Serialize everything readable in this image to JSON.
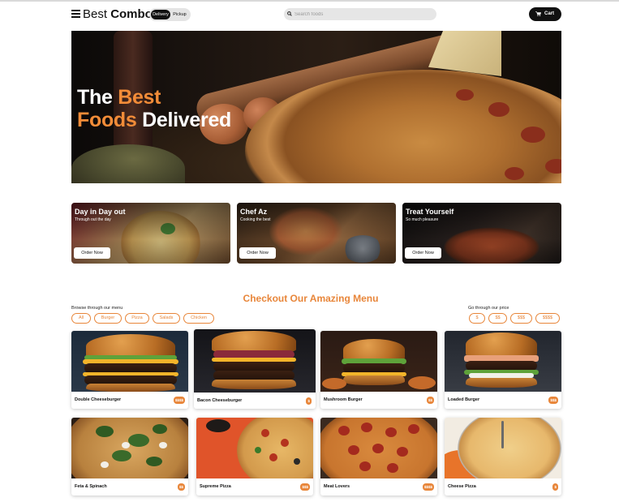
{
  "nav": {
    "brand_light": "Best",
    "brand_bold": "Combo",
    "toggle": {
      "active": "Delivery",
      "inactive": "Pickup"
    },
    "search_placeholder": "Search foods",
    "cart_label": "Cart"
  },
  "hero": {
    "line1_white": "The",
    "line1_orange": "Best",
    "line2_orange": "Foods",
    "line2_white": "Delivered"
  },
  "promos": [
    {
      "title": "Day in Day out",
      "subtitle": "Through out the day",
      "button": "Order Now"
    },
    {
      "title": "Chef Az",
      "subtitle": "Cooking the best",
      "button": "Order Now"
    },
    {
      "title": "Treat Yourself",
      "subtitle": "So much pleasure",
      "button": "Order Now"
    }
  ],
  "menu": {
    "title": "Checkout Our Amazing Menu",
    "browse_label": "Browse through our menu",
    "price_label": "Go through our price",
    "categories": [
      "All",
      "Burger",
      "Pizza",
      "Salads",
      "Chicken"
    ],
    "prices": [
      "$",
      "$$",
      "$$$",
      "$$$$"
    ],
    "items": [
      {
        "name": "Double Cheeseburger",
        "price": "$$$$"
      },
      {
        "name": "Bacon Cheeseburger",
        "price": "$"
      },
      {
        "name": "Mushroom Burger",
        "price": "$$"
      },
      {
        "name": "Loaded Burger",
        "price": "$$$"
      },
      {
        "name": "Feta & Spinach",
        "price": "$$"
      },
      {
        "name": "Supreme Pizza",
        "price": "$$$"
      },
      {
        "name": "Meat Lovers",
        "price": "$$$$"
      },
      {
        "name": "Cheese Pizza",
        "price": "$"
      }
    ]
  },
  "colors": {
    "accent": "#e8863a",
    "hero_orange": "#f28c38",
    "dark": "#111111"
  }
}
